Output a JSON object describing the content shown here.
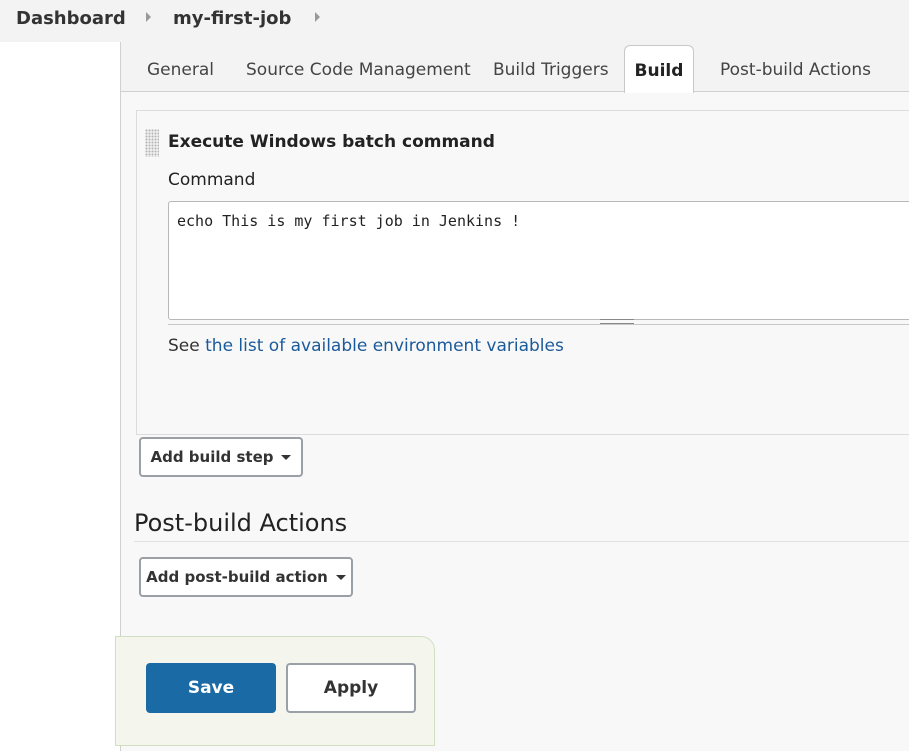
{
  "breadcrumb": {
    "items": [
      "Dashboard",
      "my-first-job"
    ]
  },
  "tabs": {
    "items": [
      "General",
      "Source Code Management",
      "Build Triggers",
      "Build",
      "Post-build Actions"
    ],
    "active": "Build"
  },
  "build_step": {
    "title": "Execute Windows batch command",
    "command_label": "Command",
    "command_value": "echo This is my first job in Jenkins !",
    "see_prefix": "See ",
    "see_link": "the list of available environment variables"
  },
  "buttons": {
    "add_build_step": "Add build step",
    "add_post_build_action": "Add post-build action",
    "save": "Save",
    "apply": "Apply"
  },
  "post_build": {
    "title": "Post-build Actions"
  },
  "colors": {
    "primary": "#1a6aa5",
    "link": "#1b5a9a"
  }
}
